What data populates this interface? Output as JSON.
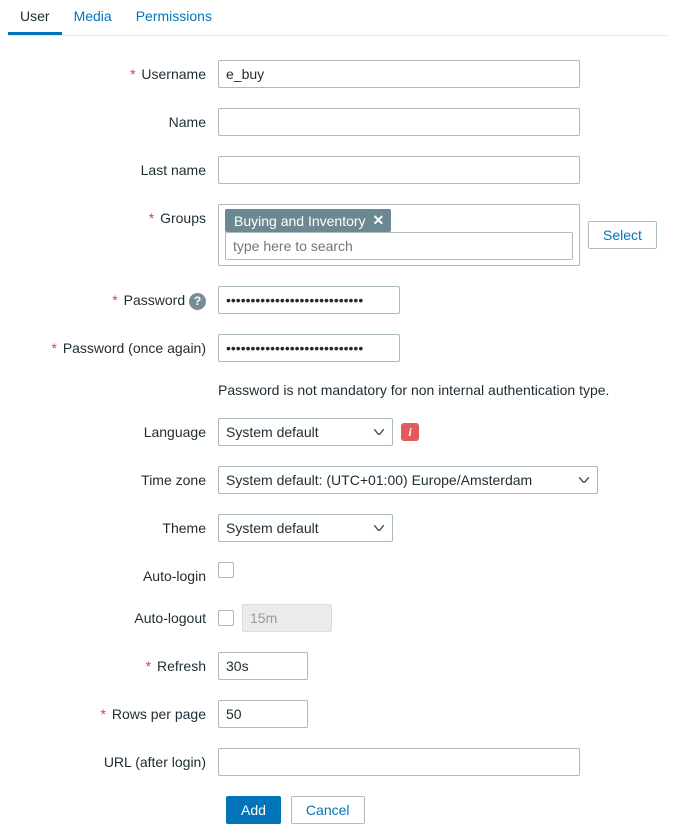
{
  "tabs": {
    "user": "User",
    "media": "Media",
    "permissions": "Permissions"
  },
  "labels": {
    "username": "Username",
    "name": "Name",
    "lastname": "Last name",
    "groups": "Groups",
    "select": "Select",
    "password": "Password",
    "password2": "Password (once again)",
    "password_hint": "Password is not mandatory for non internal authentication type.",
    "language": "Language",
    "timezone": "Time zone",
    "theme": "Theme",
    "autologin": "Auto-login",
    "autologout": "Auto-logout",
    "refresh": "Refresh",
    "rows": "Rows per page",
    "url": "URL (after login)"
  },
  "values": {
    "username": "e_buy",
    "name": "",
    "lastname": "",
    "group_chip": "Buying and Inventory",
    "groups_placeholder": "type here to search",
    "password": "••••••••••••••••••••••••••••",
    "password2": "••••••••••••••••••••••••••••",
    "language": "System default",
    "timezone": "System default: (UTC+01:00) Europe/Amsterdam",
    "theme": "System default",
    "autologout": "15m",
    "refresh": "30s",
    "rows": "50",
    "url": ""
  },
  "buttons": {
    "add": "Add",
    "cancel": "Cancel"
  }
}
